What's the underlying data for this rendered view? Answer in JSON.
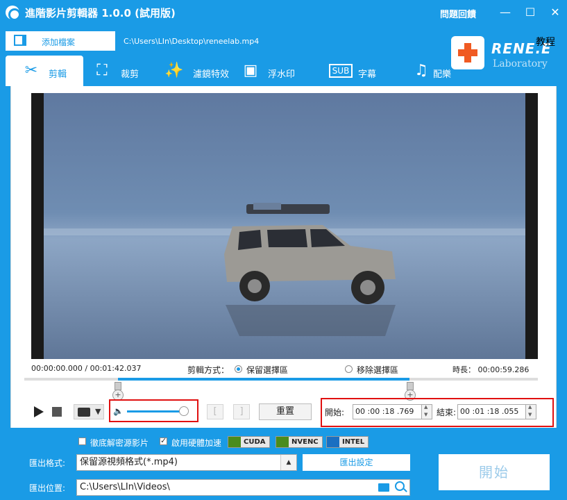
{
  "window": {
    "title": "進階影片剪輯器 1.0.0 (試用版)",
    "help_label": "問題回饋",
    "minimize": "—",
    "maximize": "☐",
    "close": "✕"
  },
  "toolbar": {
    "add_file_label": "添加檔案",
    "file_path": "C:\\Users\\LIn\\Desktop\\reneelab.mp4",
    "tutorial_label": "教程",
    "logo_text": "RENE.E",
    "logo_sub": "Laboratory"
  },
  "tabs": [
    {
      "label": "剪輯",
      "icon": "scissors-icon",
      "active": true
    },
    {
      "label": "裁剪",
      "icon": "crop-icon",
      "active": false
    },
    {
      "label": "濾鏡特效",
      "icon": "magic-wand-icon",
      "active": false
    },
    {
      "label": "浮水印",
      "icon": "watermark-icon",
      "active": false
    },
    {
      "label": "字幕",
      "icon": "subtitle-icon",
      "active": false
    },
    {
      "label": "配樂",
      "icon": "music-icon",
      "active": false
    }
  ],
  "player": {
    "time_range": "00:00:00.000 / 00:01:42.037",
    "cut_mode_label": "剪輯方式：",
    "mode_keep": "保留選擇區",
    "mode_remove": "移除選擇區",
    "selected_mode": "keep",
    "duration": "時長： 00:00:59.286",
    "volume_level": 0.85
  },
  "controls": {
    "bracket_left": "[",
    "bracket_right": "]",
    "reset_label": "重置",
    "start_label": "開始:",
    "start_value": "00 :00 :18 .769",
    "end_label": "結束:",
    "end_value": "00 :01 :18 .055"
  },
  "options": {
    "decrypt_label": "徹底解密源影片",
    "decrypt_checked": false,
    "hwaccel_label": "啟用硬體加速",
    "hwaccel_checked": true,
    "badges": [
      "CUDA",
      "NVENC",
      "INTEL"
    ]
  },
  "output": {
    "format_label": "匯出格式:",
    "format_value": "保留源視頻格式(*.mp4)",
    "settings_label": "匯出設定",
    "path_label": "匯出位置:",
    "path_value": "C:\\Users\\LIn\\Videos\\",
    "start_button": "開始"
  },
  "colors": {
    "accent": "#1a9be6",
    "highlight_box": "#e01010",
    "logo_orange": "#f05a22"
  }
}
